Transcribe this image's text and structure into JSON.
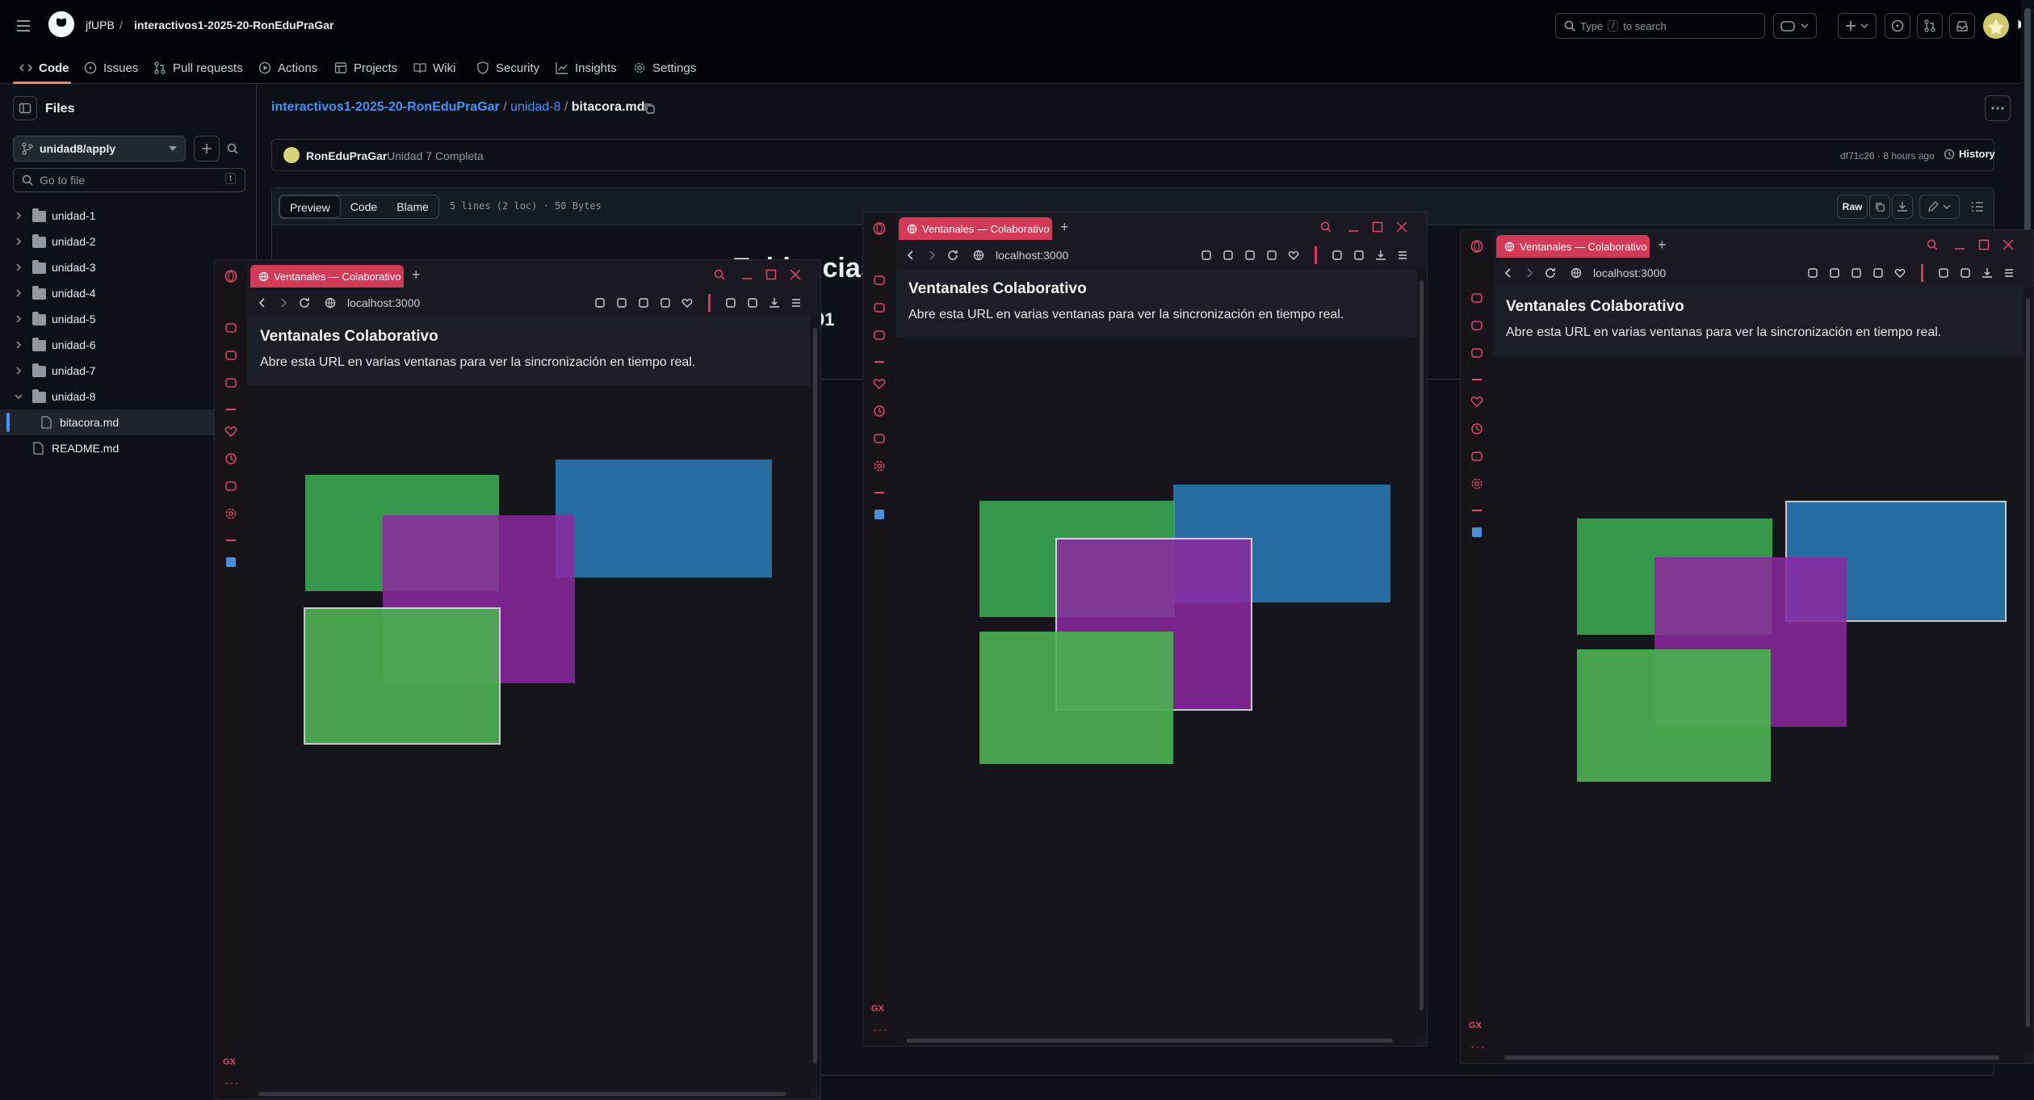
{
  "github": {
    "owner": "jfUPB",
    "separator": "/",
    "repo": "interactivos1-2025-20-RonEduPraGar",
    "search_prefix": "Type",
    "search_key": "/",
    "search_suffix": "to search",
    "nav": [
      {
        "label": "Code",
        "icon": "code-icon"
      },
      {
        "label": "Issues",
        "icon": "issue-icon"
      },
      {
        "label": "Pull requests",
        "icon": "pull-request-icon"
      },
      {
        "label": "Actions",
        "icon": "play-icon"
      },
      {
        "label": "Projects",
        "icon": "table-icon"
      },
      {
        "label": "Wiki",
        "icon": "book-icon"
      },
      {
        "label": "Security",
        "icon": "shield-icon"
      },
      {
        "label": "Insights",
        "icon": "graph-icon"
      },
      {
        "label": "Settings",
        "icon": "gear-icon"
      }
    ],
    "sidebar": {
      "title": "Files",
      "branch": "unidad8/apply",
      "goto_placeholder": "Go to file",
      "goto_key": "t",
      "tree": [
        {
          "label": "unidad-1",
          "type": "folder"
        },
        {
          "label": "unidad-2",
          "type": "folder"
        },
        {
          "label": "unidad-3",
          "type": "folder"
        },
        {
          "label": "unidad-4",
          "type": "folder"
        },
        {
          "label": "unidad-5",
          "type": "folder"
        },
        {
          "label": "unidad-6",
          "type": "folder"
        },
        {
          "label": "unidad-7",
          "type": "folder"
        },
        {
          "label": "unidad-8",
          "type": "folder-open"
        },
        {
          "label": "bitacora.md",
          "type": "file-selected"
        },
        {
          "label": "README.md",
          "type": "file"
        }
      ]
    },
    "breadcrumb": {
      "repo": "interactivos1-2025-20-RonEduPraGar",
      "sep": "/",
      "dir": "unidad-8",
      "file": "bitacora.md"
    },
    "commit": {
      "author": "RonEduPraGar",
      "message": "Unidad 7 Completa",
      "hash_time": "df71c26 · 8 hours ago",
      "history": "History"
    },
    "file_tabs": {
      "preview": "Preview",
      "code": "Code",
      "blame": "Blame",
      "info": "5 lines (2 loc) · 50 Bytes",
      "raw": "Raw"
    },
    "peek_heading": "Evidencias d",
    "peek_num": "01"
  },
  "windows": [
    {
      "tab": "Ventanales — Colaborativo",
      "url": "localhost:3000",
      "title": "Ventanales Colaborativo",
      "text": "Abre esta URL en varias ventanas para ver la sincronización en tiempo real."
    },
    {
      "tab": "Ventanales — Colaborativo",
      "url": "localhost:3000",
      "title": "Ventanales Colaborativo",
      "text": "Abre esta URL en varias ventanas para ver la sincronización en tiempo real."
    },
    {
      "tab": "Ventanales — Colaborativo",
      "url": "localhost:3000",
      "title": "Ventanales Colaborativo",
      "text": "Abre esta URL en varias ventanas para ver la sincronización en tiempo real."
    }
  ],
  "browser_sidebar_label": "GX",
  "colors": {
    "gx_accent": "#d23a57",
    "link": "#4493f8",
    "green": "#3caf55",
    "blue": "#2a82be",
    "purple": "#8c28a0"
  }
}
